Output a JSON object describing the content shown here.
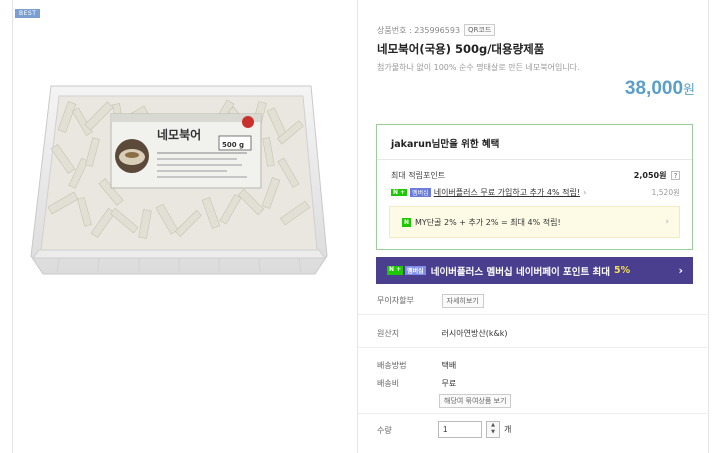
{
  "badge": "BEST",
  "product": {
    "id_label": "상품번호 : 235996593",
    "qr_label": "QR코드",
    "title": "네모북어(국용) 500g/대용량제품",
    "description": "첨가물하나 없이 100% 순수 명태살로 만든 네모북어입니다.",
    "price_number": "38,000",
    "price_unit": "원",
    "package_label": "네모북어",
    "package_weight": "500 g"
  },
  "benefit": {
    "title": "jakarun님만을 위한 혜택",
    "points_label": "최대 적립포인트",
    "points_value": "2,050원",
    "points_help": "?",
    "np_tag1": "N +",
    "np_tag2": "멤버십",
    "np_text": "네이버플러스 무료 가입하고 추가 4% 적립!",
    "np_chev": "›",
    "np_value": "1,520원",
    "my_tag": "N",
    "my_text": "MY단골 2% + 추가 2% = 최대  4%  적립!",
    "my_chev": "›"
  },
  "banner": {
    "tag1": "N +",
    "tag2": "멤버십",
    "text": "네이버플러스 멤버십 네이버페이 포인트 최대",
    "percent": "5%",
    "chev": "›"
  },
  "rows": {
    "installment_label": "무이자할부",
    "installment_button": "자세히보기",
    "origin_label": "원산지",
    "origin_value": "러시아연방산(k&k)",
    "delivery_label": "배송방법",
    "delivery_value": "택배",
    "fee_label": "배송비",
    "fee_value": "무료",
    "fee_button": "해당여 묶여상품 보기",
    "qty_label": "수량",
    "qty_value": "1",
    "qty_unit": "개"
  }
}
